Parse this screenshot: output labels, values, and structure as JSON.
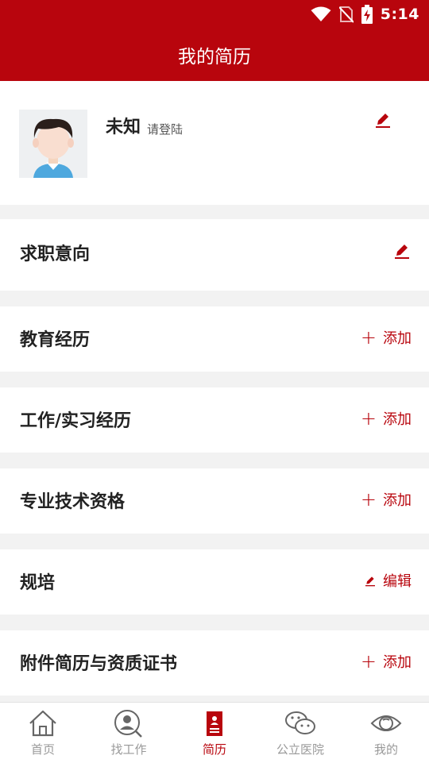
{
  "status_bar": {
    "time": "5:14"
  },
  "header": {
    "title": "我的简历"
  },
  "profile": {
    "name": "未知",
    "login_hint": "请登陆"
  },
  "sections": [
    {
      "title": "求职意向",
      "action_label": "",
      "action_type": "edit-icon"
    },
    {
      "title": "教育经历",
      "action_label": "添加",
      "action_type": "add"
    },
    {
      "title": "工作/实习经历",
      "action_label": "添加",
      "action_type": "add"
    },
    {
      "title": "专业技术资格",
      "action_label": "添加",
      "action_type": "add"
    },
    {
      "title": "规培",
      "action_label": "编辑",
      "action_type": "edit"
    },
    {
      "title": "附件简历与资质证书",
      "action_label": "添加",
      "action_type": "add"
    }
  ],
  "tabs": [
    {
      "label": "首页",
      "icon": "home-icon",
      "active": false
    },
    {
      "label": "找工作",
      "icon": "person-search-icon",
      "active": false
    },
    {
      "label": "简历",
      "icon": "resume-icon",
      "active": true
    },
    {
      "label": "公立医院",
      "icon": "wechat-icon",
      "active": false
    },
    {
      "label": "我的",
      "icon": "eye-icon",
      "active": false
    }
  ],
  "colors": {
    "brand": "#b8050d",
    "inactive": "#999999",
    "background": "#f2f2f2"
  }
}
